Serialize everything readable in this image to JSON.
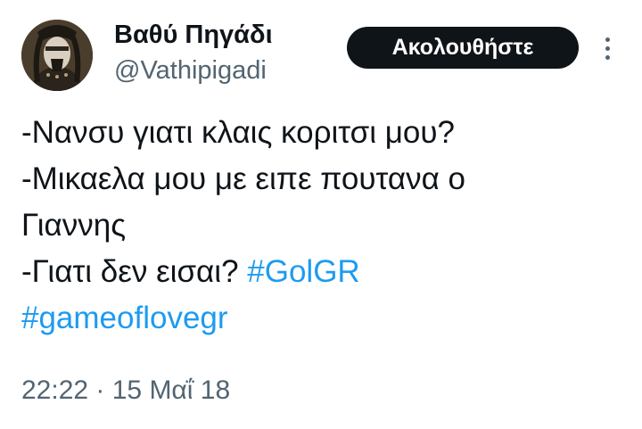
{
  "author": {
    "display_name": "Βαθύ Πηγάδι",
    "handle": "@Vathipigadi"
  },
  "actions": {
    "follow_label": "Ακολουθήστε",
    "more_icon": "more-vertical-icon"
  },
  "tweet": {
    "line1": "-Νανσυ γιατι κλαις κοριτσι μου?",
    "line2": "-Μικαελα μου με ειπε πουτανα ο",
    "line3": "Γιαννης",
    "line4_text": "-Γιατι δεν εισαι? ",
    "hashtag1": "#GolGR",
    "hashtag2": "#gameoflovegr"
  },
  "timestamp": "22:22 · 15 Μαΐ 18",
  "colors": {
    "text": "#0f1419",
    "secondary": "#536471",
    "link": "#1d9bf0",
    "button_bg": "#0f1419"
  }
}
